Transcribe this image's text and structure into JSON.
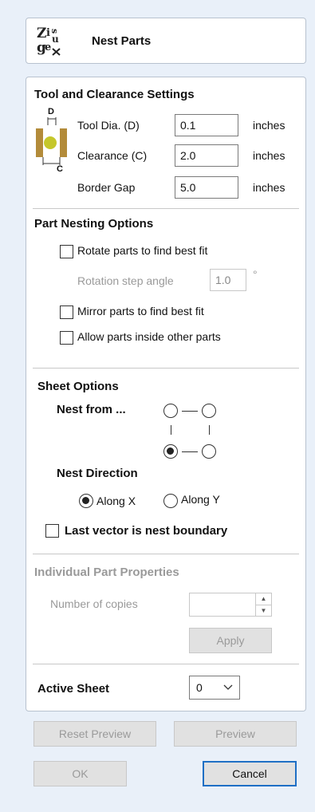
{
  "header": {
    "title": "Nest Parts",
    "logo_icon": "zig-zag-logo-icon"
  },
  "tool_section": {
    "title": "Tool and Clearance Settings",
    "diagram_label_d": "D",
    "diagram_label_c": "C",
    "rows": [
      {
        "label": "Tool Dia. (D)",
        "value": "0.1",
        "unit": "inches"
      },
      {
        "label": "Clearance (C)",
        "value": "2.0",
        "unit": "inches"
      },
      {
        "label": "Border Gap",
        "value": "5.0",
        "unit": "inches"
      }
    ]
  },
  "nesting_section": {
    "title": "Part Nesting Options",
    "rotate_label": "Rotate parts to find best fit",
    "rotate_checked": false,
    "rotation_step_label": "Rotation step angle",
    "rotation_step_value": "1.0",
    "rotation_step_unit": "°",
    "mirror_label": "Mirror parts to find best fit",
    "mirror_checked": false,
    "inside_label": "Allow parts inside other parts",
    "inside_checked": false
  },
  "sheet_section": {
    "title": "Sheet Options",
    "nest_from_label": "Nest from ...",
    "nest_from_selected": "bottom-left",
    "nest_direction_label": "Nest Direction",
    "along_x_label": "Along X",
    "along_y_label": "Along Y",
    "direction_selected": "Along X",
    "last_vector_label": "Last vector is nest boundary",
    "last_vector_checked": false
  },
  "individual_section": {
    "title": "Individual Part Properties",
    "copies_label": "Number of copies",
    "copies_value": "",
    "apply_label": "Apply"
  },
  "active_sheet": {
    "label": "Active Sheet",
    "value": "0"
  },
  "buttons": {
    "reset_preview": "Reset Preview",
    "preview": "Preview",
    "ok": "OK",
    "cancel": "Cancel"
  }
}
